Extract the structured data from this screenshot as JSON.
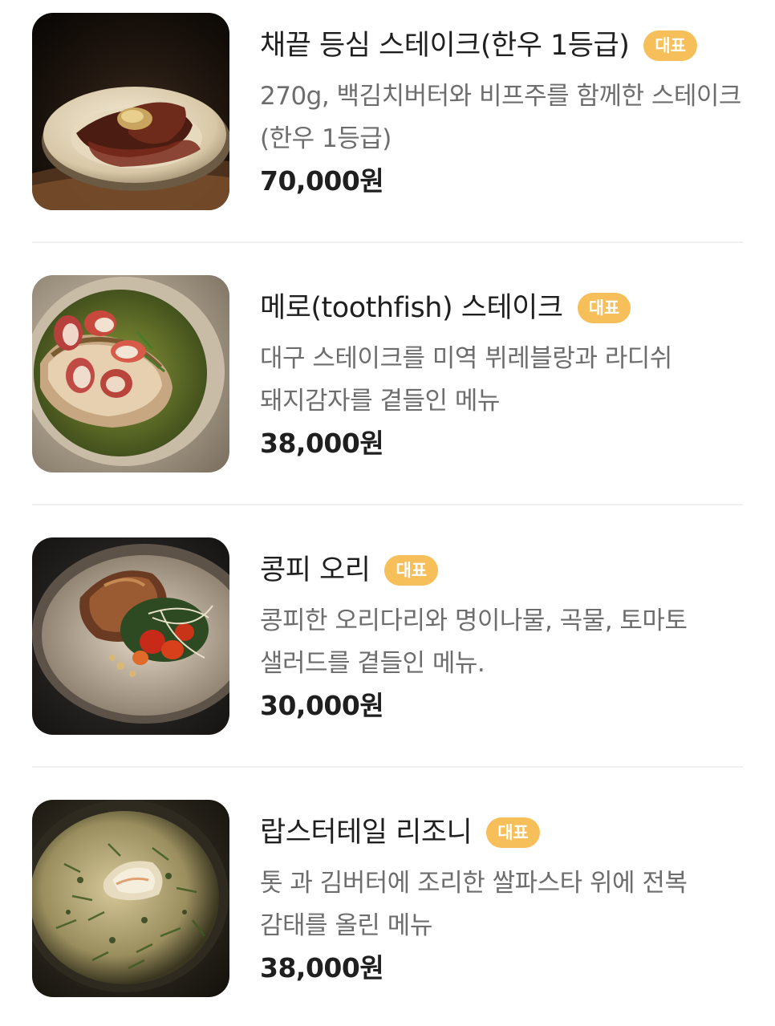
{
  "items": [
    {
      "title": "채끝 등심 스테이크(한우 1등급)",
      "badge": "대표",
      "description": "270g, 백김치버터와 비프주를 함께한 스테이크(한우 1등급)",
      "price": "70,000원",
      "image": "steak-photo"
    },
    {
      "title": "메로(toothfish) 스테이크",
      "badge": "대표",
      "description": "대구 스테이크를 미역 뷔레블랑과 라디쉬 돼지감자를 곁들인 메뉴",
      "price": "38,000원",
      "image": "toothfish-photo"
    },
    {
      "title": "콩피 오리",
      "badge": "대표",
      "description": "콩피한 오리다리와 명이나물, 곡물, 토마토 샐러드를 곁들인 메뉴.",
      "price": "30,000원",
      "image": "duck-photo"
    },
    {
      "title": "랍스터테일 리조니",
      "badge": "대표",
      "description": "톳 과 김버터에 조리한 쌀파스타 위에 전복 감태를 올린 메뉴",
      "price": "38,000원",
      "image": "risoni-photo"
    }
  ],
  "colors": {
    "badge_bg": "#f6bf5a",
    "title": "#1f1f1f",
    "description": "#6d6d6d",
    "divider": "#f0f0f0"
  }
}
